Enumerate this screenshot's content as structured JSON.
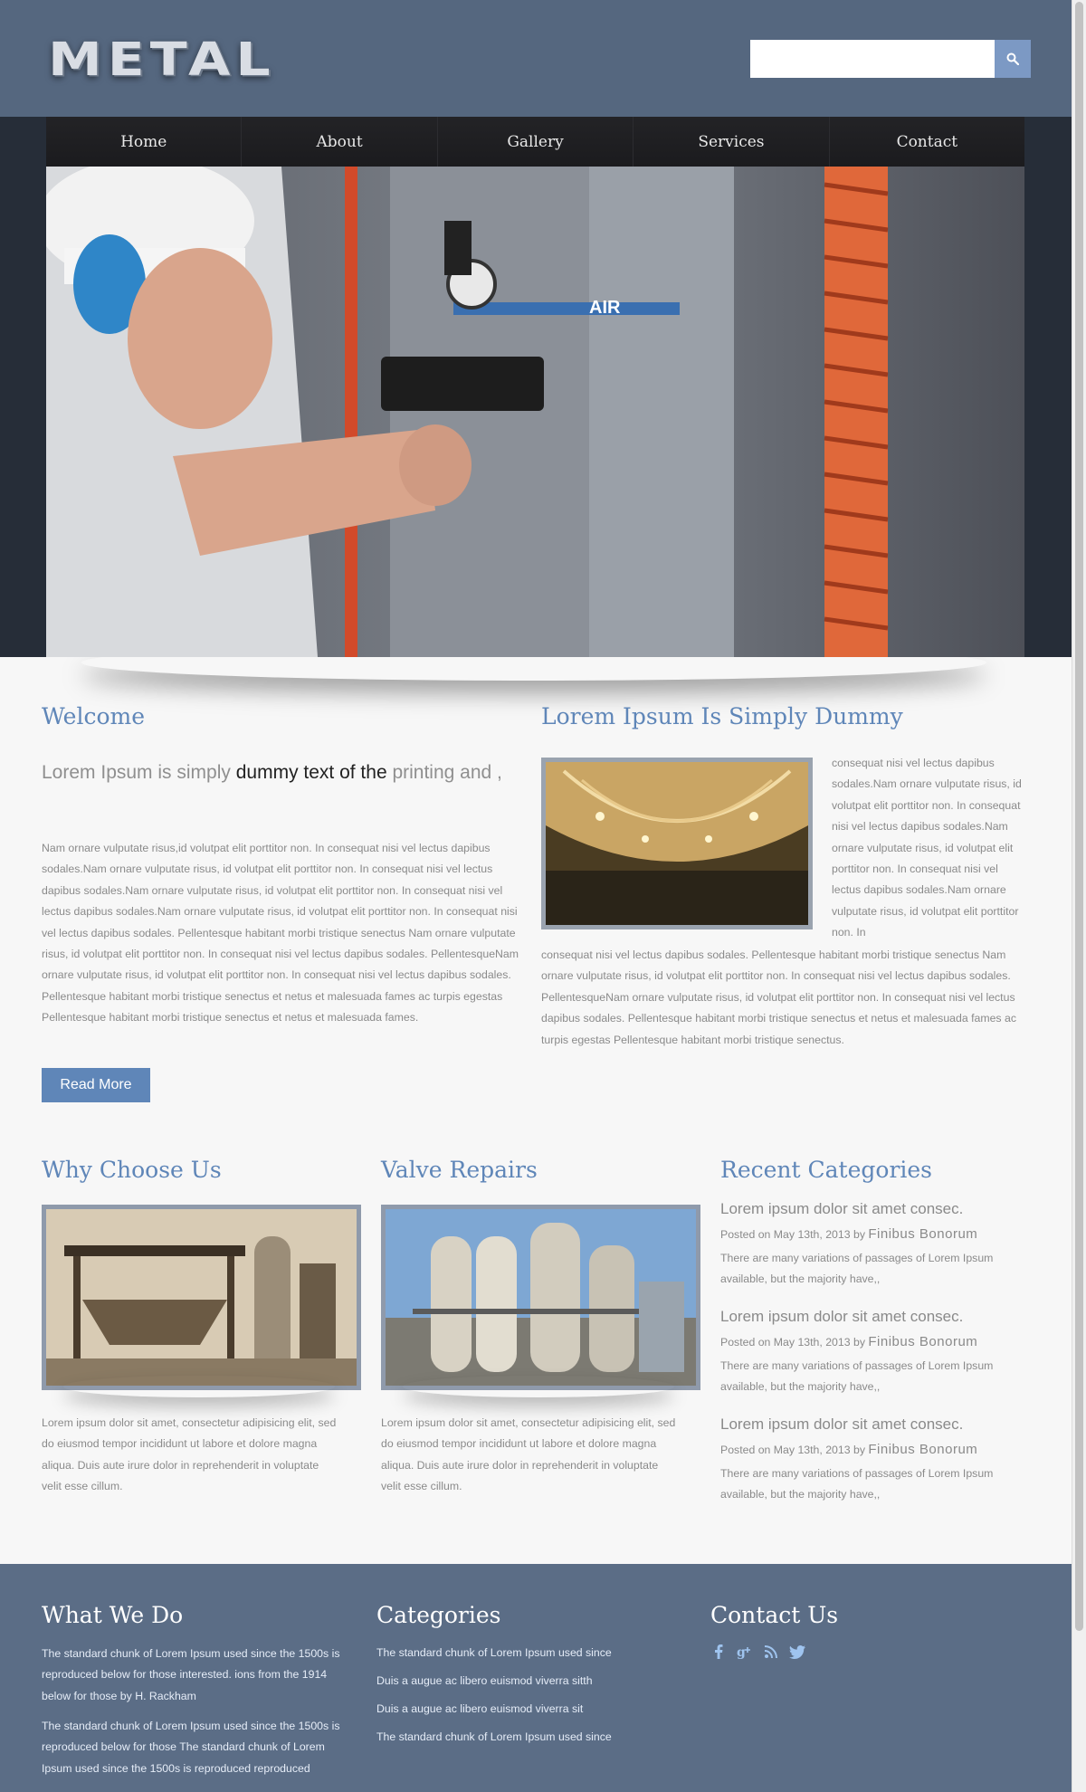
{
  "header": {
    "logo": "METAL",
    "search_placeholder": "",
    "search_button_icon": "search-icon"
  },
  "nav": {
    "items": [
      "Home",
      "About",
      "Gallery",
      "Services",
      "Contact"
    ]
  },
  "welcome": {
    "title": "Welcome",
    "lead_part1": "Lorem Ipsum is simply ",
    "lead_part2": "dummy text of the",
    "lead_part3": " printing and ,",
    "body": "Nam ornare vulputate risus,id volutpat elit porttitor non. In consequat nisi vel lectus dapibus sodales.Nam ornare vulputate risus, id volutpat elit porttitor non. In consequat nisi vel lectus dapibus sodales.Nam ornare vulputate risus, id volutpat elit porttitor non. In consequat nisi vel lectus dapibus sodales.Nam ornare vulputate risus, id volutpat elit porttitor non. In consequat nisi vel lectus dapibus sodales. Pellentesque habitant morbi tristique senectus Nam ornare vulputate risus, id volutpat elit porttitor non. In consequat nisi vel lectus dapibus sodales. PellentesqueNam ornare vulputate risus, id volutpat elit porttitor non. In consequat nisi vel lectus dapibus sodales. Pellentesque habitant morbi tristique senectus et netus et malesuada fames ac turpis egestas Pellentesque habitant morbi tristique senectus et netus et malesuada fames.",
    "read_more": "Read More"
  },
  "lorem": {
    "title": "Lorem Ipsum Is Simply Dummy",
    "side_text": "consequat nisi vel lectus dapibus sodales.Nam ornare vulputate risus, id volutpat elit porttitor non. In consequat nisi vel lectus dapibus sodales.Nam ornare vulputate risus, id volutpat elit porttitor non. In consequat nisi vel lectus dapibus sodales.Nam ornare vulputate risus, id volutpat elit porttitor non. In",
    "bottom_text": "consequat nisi vel lectus dapibus sodales. Pellentesque habitant morbi tristique senectus Nam ornare vulputate risus, id volutpat elit porttitor non. In consequat nisi vel lectus dapibus sodales. PellentesqueNam ornare vulputate risus, id volutpat elit porttitor non. In consequat nisi vel lectus dapibus sodales. Pellentesque habitant morbi tristique senectus et netus et malesuada fames ac turpis egestas Pellentesque habitant morbi tristique senectus."
  },
  "why": {
    "title": "Why Choose Us",
    "text": "Lorem ipsum dolor sit amet, consectetur adipisicing elit, sed do eiusmod tempor incididunt ut labore et dolore magna aliqua. Duis aute irure dolor in reprehenderit in voluptate velit esse cillum."
  },
  "valve": {
    "title": "Valve Repairs",
    "text": "Lorem ipsum dolor sit amet, consectetur adipisicing elit, sed do eiusmod tempor incididunt ut labore et dolore magna aliqua. Duis aute irure dolor in reprehenderit in voluptate velit esse cillum."
  },
  "recent": {
    "title": "Recent Categories",
    "items": [
      {
        "heading": "Lorem ipsum dolor sit amet consec.",
        "posted": "Posted on May 13th, 2013 by ",
        "author": "Finibus Bonorum",
        "desc": "There are many variations of passages of Lorem Ipsum available, but the majority have,,"
      },
      {
        "heading": "Lorem ipsum dolor sit amet consec.",
        "posted": "Posted on May 13th, 2013 by ",
        "author": "Finibus Bonorum",
        "desc": "There are many variations of passages of Lorem Ipsum available, but the majority have,,"
      },
      {
        "heading": "Lorem ipsum dolor sit amet consec.",
        "posted": "Posted on May 13th, 2013 by ",
        "author": "Finibus Bonorum",
        "desc": "There are many variations of passages of Lorem Ipsum available, but the majority have,,"
      }
    ]
  },
  "footer": {
    "what_title": "What We Do",
    "what_p1": "The standard chunk of Lorem Ipsum used since the 1500s is reproduced below for those interested. ions from the 1914 below for those by H. Rackham",
    "what_p2": "The standard chunk of Lorem Ipsum used since the 1500s is reproduced below for those The standard chunk of Lorem Ipsum used since the 1500s is reproduced reproduced",
    "categories_title": "Categories",
    "categories": [
      "The standard chunk of Lorem Ipsum used since",
      "Duis a augue ac libero euismod viverra sitth",
      "Duis a augue ac libero euismod viverra sit",
      "The standard chunk of Lorem Ipsum used since"
    ],
    "contact_title": "Contact Us",
    "social": [
      {
        "icon": "facebook-icon",
        "glyph": "f"
      },
      {
        "icon": "google-plus-icon",
        "glyph": "g+"
      },
      {
        "icon": "rss-icon",
        "glyph": "rss"
      },
      {
        "icon": "twitter-icon",
        "glyph": "tw"
      }
    ]
  },
  "colors": {
    "header_bg": "#55677f",
    "accent": "#5f86b8",
    "footer_bg": "#5b6d86",
    "nav_bg": "#1f1f22"
  }
}
